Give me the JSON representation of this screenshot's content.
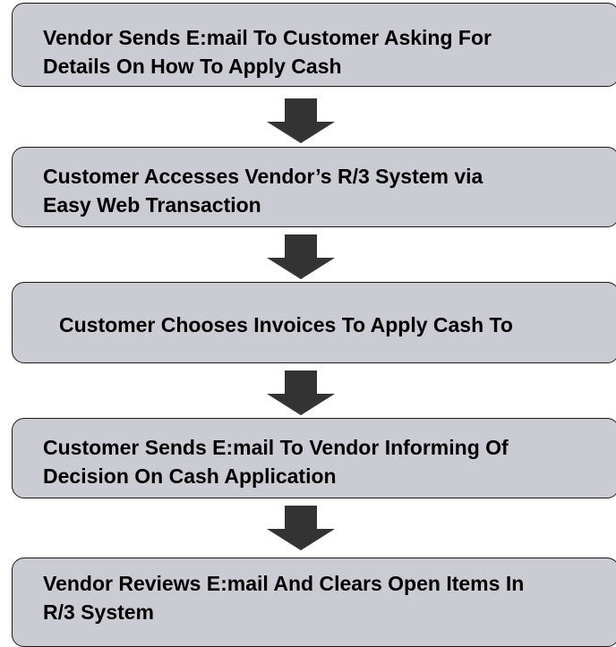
{
  "steps": [
    {
      "line1": "Vendor Sends E:mail To Customer Asking For",
      "line2": "Details On How To Apply Cash"
    },
    {
      "line1": "Customer Accesses Vendor’s R/3 System via",
      "line2": "Easy Web Transaction"
    },
    {
      "line1": "Customer Chooses Invoices To Apply Cash To",
      "line2": ""
    },
    {
      "line1": "Customer Sends E:mail To Vendor Informing Of",
      "line2": "Decision On Cash Application"
    },
    {
      "line1": "Vendor Reviews E:mail And Clears Open Items In",
      "line2": "R/3 System"
    }
  ],
  "colors": {
    "box_fill": "#cbcbd3",
    "box_border": "#1a1a1a",
    "arrow": "#333333",
    "text": "#000000"
  }
}
